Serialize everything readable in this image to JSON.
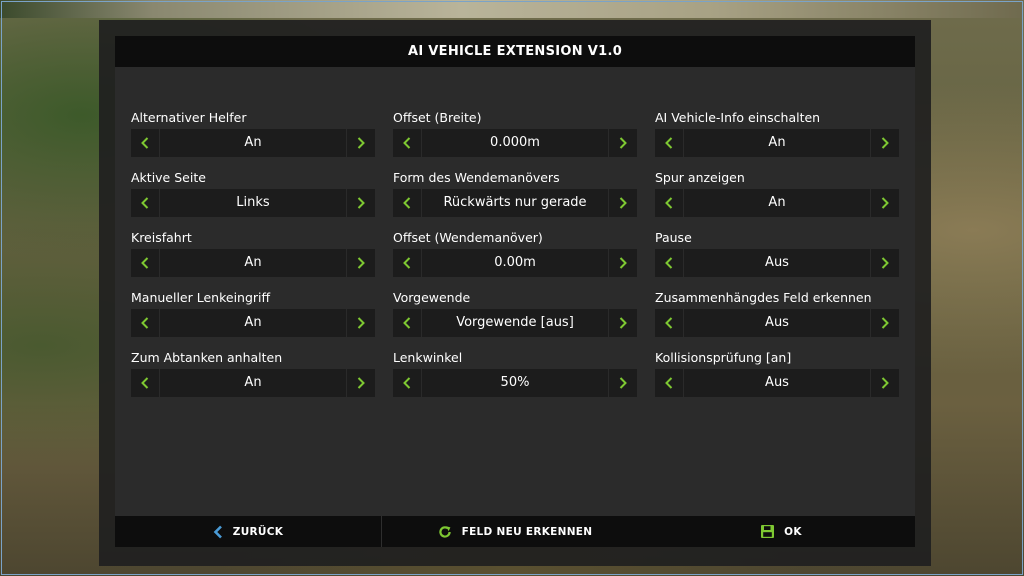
{
  "dialog": {
    "title": "AI VEHICLE EXTENSION V1.0"
  },
  "colors": {
    "accent": "#7ec832",
    "back_icon": "#4a9bd6"
  },
  "settings": {
    "col1": [
      {
        "label": "Alternativer Helfer",
        "value": "An"
      },
      {
        "label": "Aktive Seite",
        "value": "Links"
      },
      {
        "label": "Kreisfahrt",
        "value": "An"
      },
      {
        "label": "Manueller Lenkeingriff",
        "value": "An"
      },
      {
        "label": "Zum Abtanken anhalten",
        "value": "An"
      }
    ],
    "col2": [
      {
        "label": "Offset (Breite)",
        "value": "0.000m"
      },
      {
        "label": "Form des Wendemanövers",
        "value": "Rückwärts nur gerade"
      },
      {
        "label": "Offset (Wendemanöver)",
        "value": "0.00m"
      },
      {
        "label": "Vorgewende",
        "value": "Vorgewende [aus]"
      },
      {
        "label": "Lenkwinkel",
        "value": "50%"
      }
    ],
    "col3": [
      {
        "label": "AI Vehicle-Info einschalten",
        "value": "An"
      },
      {
        "label": "Spur anzeigen",
        "value": "An"
      },
      {
        "label": "Pause",
        "value": "Aus"
      },
      {
        "label": "Zusammenhängdes Feld erkennen",
        "value": "Aus"
      },
      {
        "label": "Kollisionsprüfung [an]",
        "value": "Aus"
      }
    ]
  },
  "footer": {
    "back_label": "ZURÜCK",
    "back_icon": "chevron-left-icon",
    "rescan_label": "FELD NEU ERKENNEN",
    "rescan_icon": "refresh-icon",
    "ok_label": "OK",
    "ok_icon": "save-icon"
  }
}
